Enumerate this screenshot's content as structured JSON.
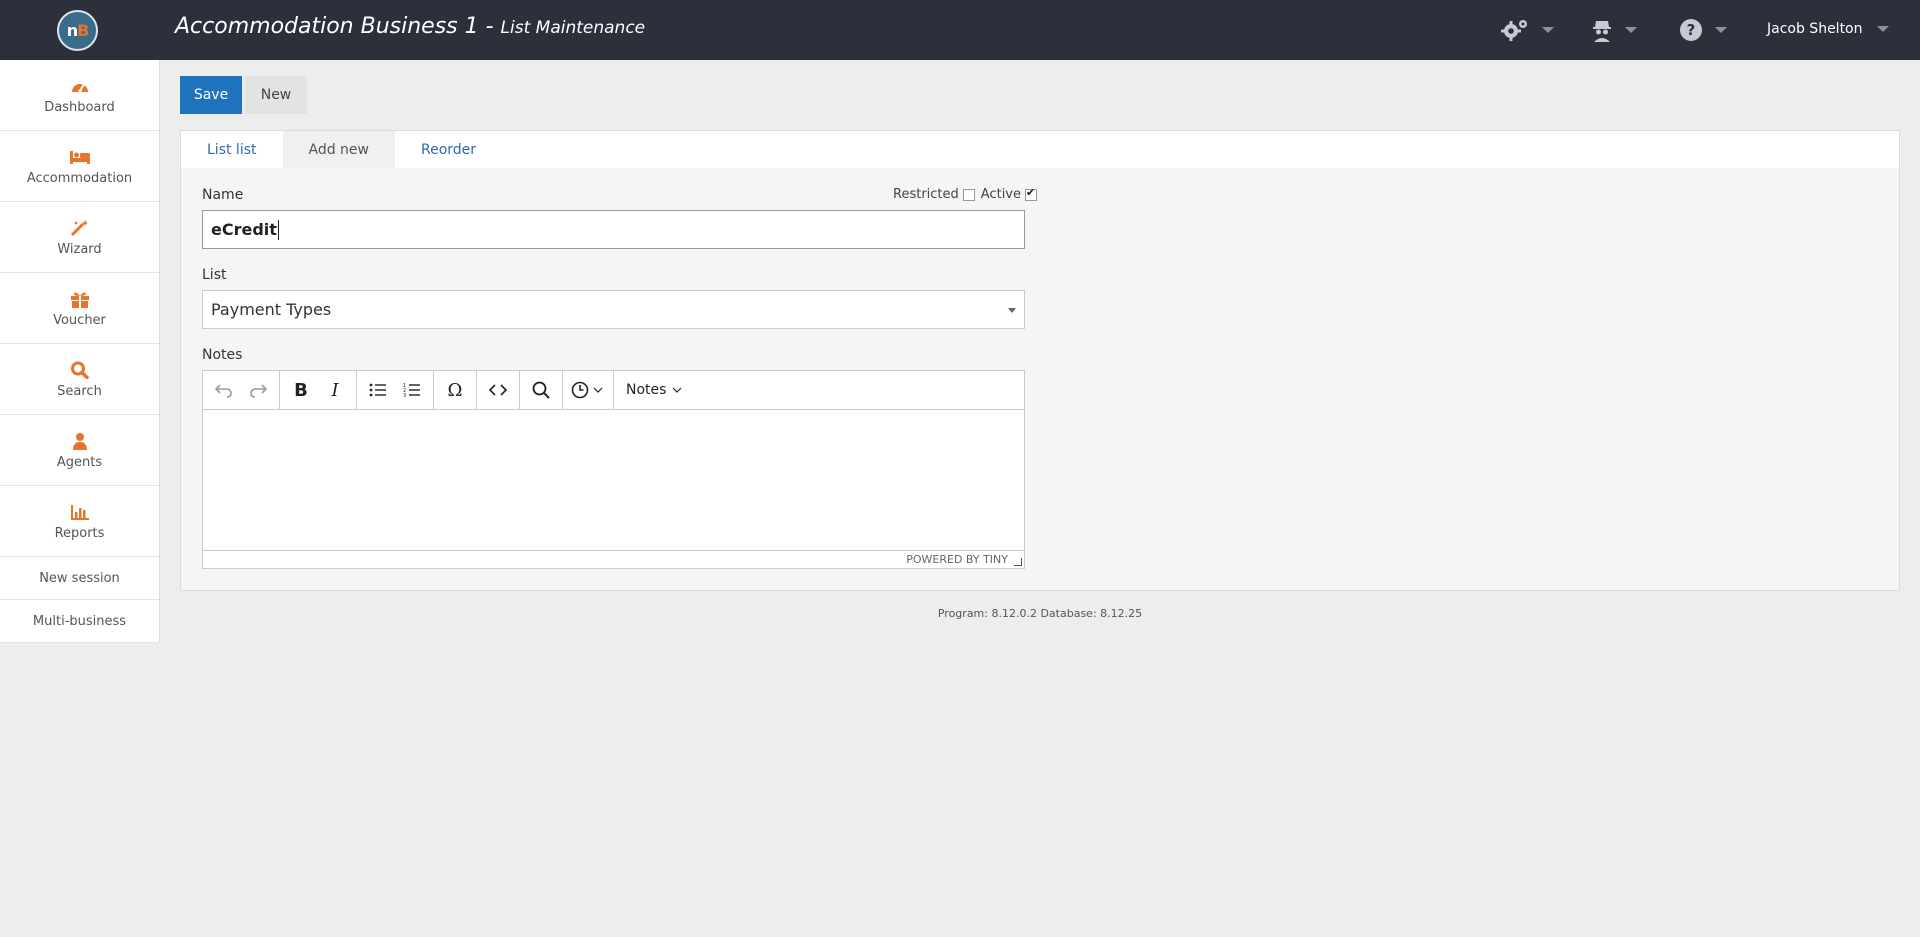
{
  "header": {
    "logo_text": "nB",
    "title": "Accommodation Business 1 - ",
    "subtitle": "List Maintenance",
    "user_name": "Jacob Shelton",
    "icons": [
      "gears-icon",
      "agent-icon",
      "help-icon"
    ]
  },
  "sidebar": {
    "items": [
      {
        "label": "Dashboard",
        "icon": "dashboard-icon"
      },
      {
        "label": "Accommodation",
        "icon": "bed-icon"
      },
      {
        "label": "Wizard",
        "icon": "magic-wand-icon"
      },
      {
        "label": "Voucher",
        "icon": "gift-icon"
      },
      {
        "label": "Search",
        "icon": "search-icon"
      },
      {
        "label": "Agents",
        "icon": "user-icon"
      },
      {
        "label": "Reports",
        "icon": "bar-chart-icon"
      }
    ],
    "links": [
      "New session",
      "Multi-business"
    ]
  },
  "toolbar": {
    "save_label": "Save",
    "new_label": "New"
  },
  "tabs": [
    "List list",
    "Add new",
    "Reorder"
  ],
  "form": {
    "name_label": "Name",
    "name_value": "eCredit",
    "restricted_label": "Restricted",
    "active_label": "Active",
    "list_label": "List",
    "list_value": "Payment Types",
    "notes_label": "Notes",
    "notes_menu": "Notes",
    "powered_by": "POWERED BY TINY"
  },
  "footer": {
    "version": "Program: 8.12.0.2 Database: 8.12.25"
  },
  "colors": {
    "accent": "#1e73be",
    "sidebar_icon": "#e8742a",
    "header_bg": "#2d303a"
  }
}
